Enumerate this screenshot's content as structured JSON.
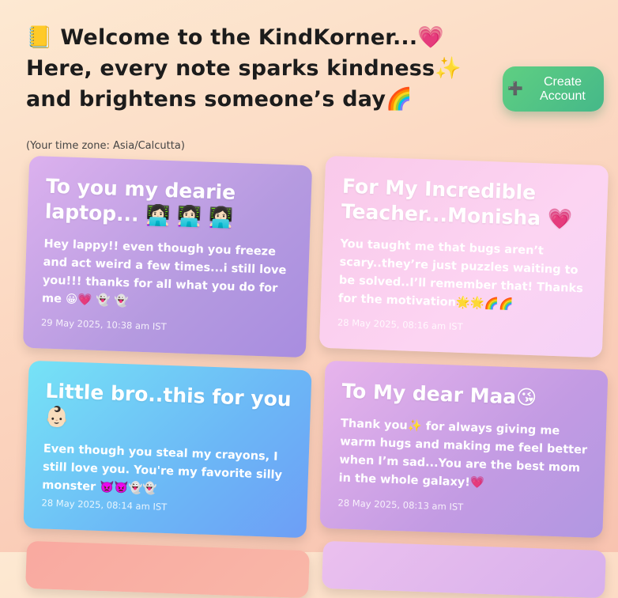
{
  "header": {
    "welcome": "📒 Welcome to the KindKorner...💗",
    "tagline": "Here, every note sparks kindness✨ and brightens someone’s day🌈"
  },
  "create_account": {
    "plus": "➕",
    "label": "Create Account"
  },
  "timezone_text": "(Your time zone: Asia/Calcutta)",
  "notes": [
    {
      "title": "To you my dearie laptop... 👩🏻‍💻 👩🏻‍💻 👩🏻‍💻",
      "message": "Hey lappy!! even though you freeze and act weird a few times...i still love you!!! thanks for all what you do for me 😀💗 👻 👻",
      "date": "29 May 2025, 10:38 am IST"
    },
    {
      "title": "For My Incredible Teacher...Monisha 💗",
      "message": "You taught me that bugs aren’t scary..they’re just puzzles waiting to be solved..I’ll remember that! Thanks for the motivation🌟🌟🌈🌈",
      "date": "28 May 2025, 08:16 am IST"
    },
    {
      "title": "Little bro..this for you👶🏻",
      "message": "Even though you steal my crayons, I still love you. You're my favorite silly monster 👿👿👻👻",
      "date": "28 May 2025, 08:14 am IST"
    },
    {
      "title": "To My dear Maa😘",
      "message": "Thank you✨ for always giving me warm hugs and making me feel better when I’m sad...You are the best mom in the whole galaxy!💗",
      "date": "28 May 2025, 08:13 am IST"
    }
  ]
}
